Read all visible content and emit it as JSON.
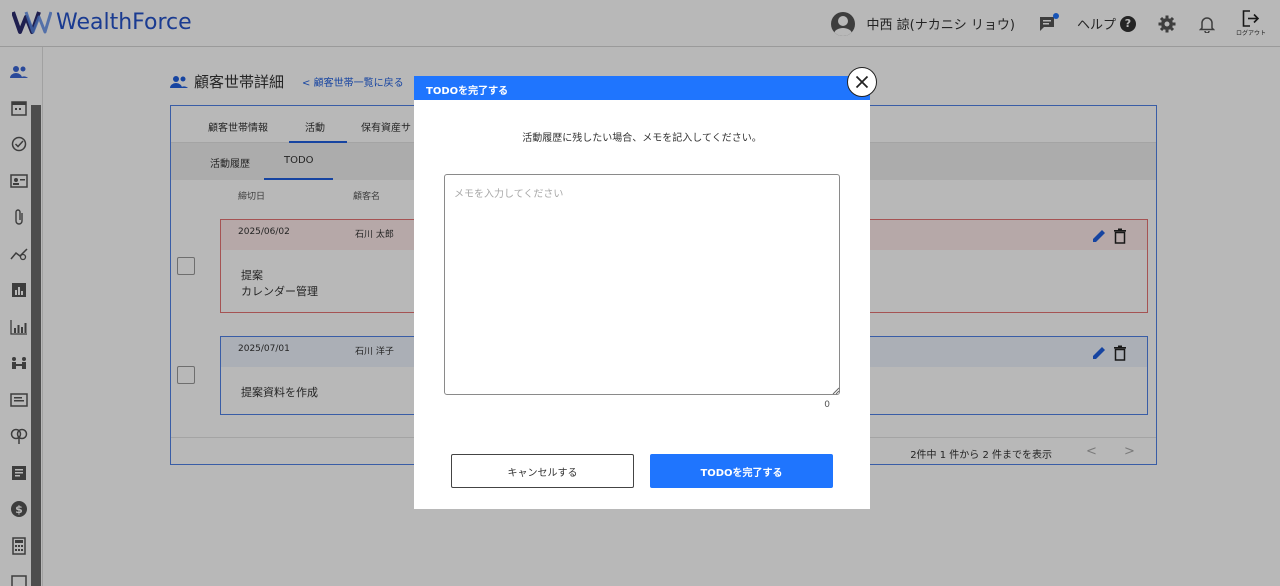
{
  "app": {
    "logo_text": "WealthForce"
  },
  "header": {
    "user_name": "中西 諒(ナカニシ リョウ)",
    "help_label": "ヘルプ",
    "help_symbol": "?",
    "logout_label": "ログアウト"
  },
  "sidebar": {
    "items": [
      "users-icon",
      "calendar-icon",
      "check-circle-icon",
      "id-card-icon",
      "clip-icon",
      "trend-icon",
      "bar-chart-icon",
      "analytics-icon",
      "meeting-icon",
      "document-icon",
      "ring-icon",
      "note-icon",
      "dollar-icon",
      "calculator-icon"
    ]
  },
  "page": {
    "title": "顧客世帯詳細",
    "back_link": "< 顧客世帯一覧に戻る",
    "tabs": [
      "顧客世帯情報",
      "活動",
      "保有資産サ"
    ],
    "subtabs": [
      "活動履歴",
      "TODO"
    ],
    "columns": [
      "締切日",
      "顧客名"
    ],
    "cards": [
      {
        "date": "2025/06/02",
        "name": "石川 太郎",
        "lines": [
          "提案",
          "カレンダー管理"
        ]
      },
      {
        "date": "2025/07/01",
        "name": "石川 洋子",
        "lines": [
          "提案資料を作成"
        ]
      }
    ],
    "pager_text": "2件中 1 件から 2 件までを表示",
    "pager_prev": "<",
    "pager_next": ">"
  },
  "modal": {
    "title": "TODOを完了する",
    "message": "活動履歴に残したい場合、メモを記入してください。",
    "memo_placeholder": "メモを入力してください",
    "memo_value": "",
    "char_count": "0",
    "cancel_label": "キャンセルする",
    "confirm_label": "TODOを完了する"
  },
  "colors": {
    "brand": "#2452c9",
    "primary": "#1f75fe",
    "overdue_border": "#e57373",
    "card_border": "#4f82e6"
  }
}
